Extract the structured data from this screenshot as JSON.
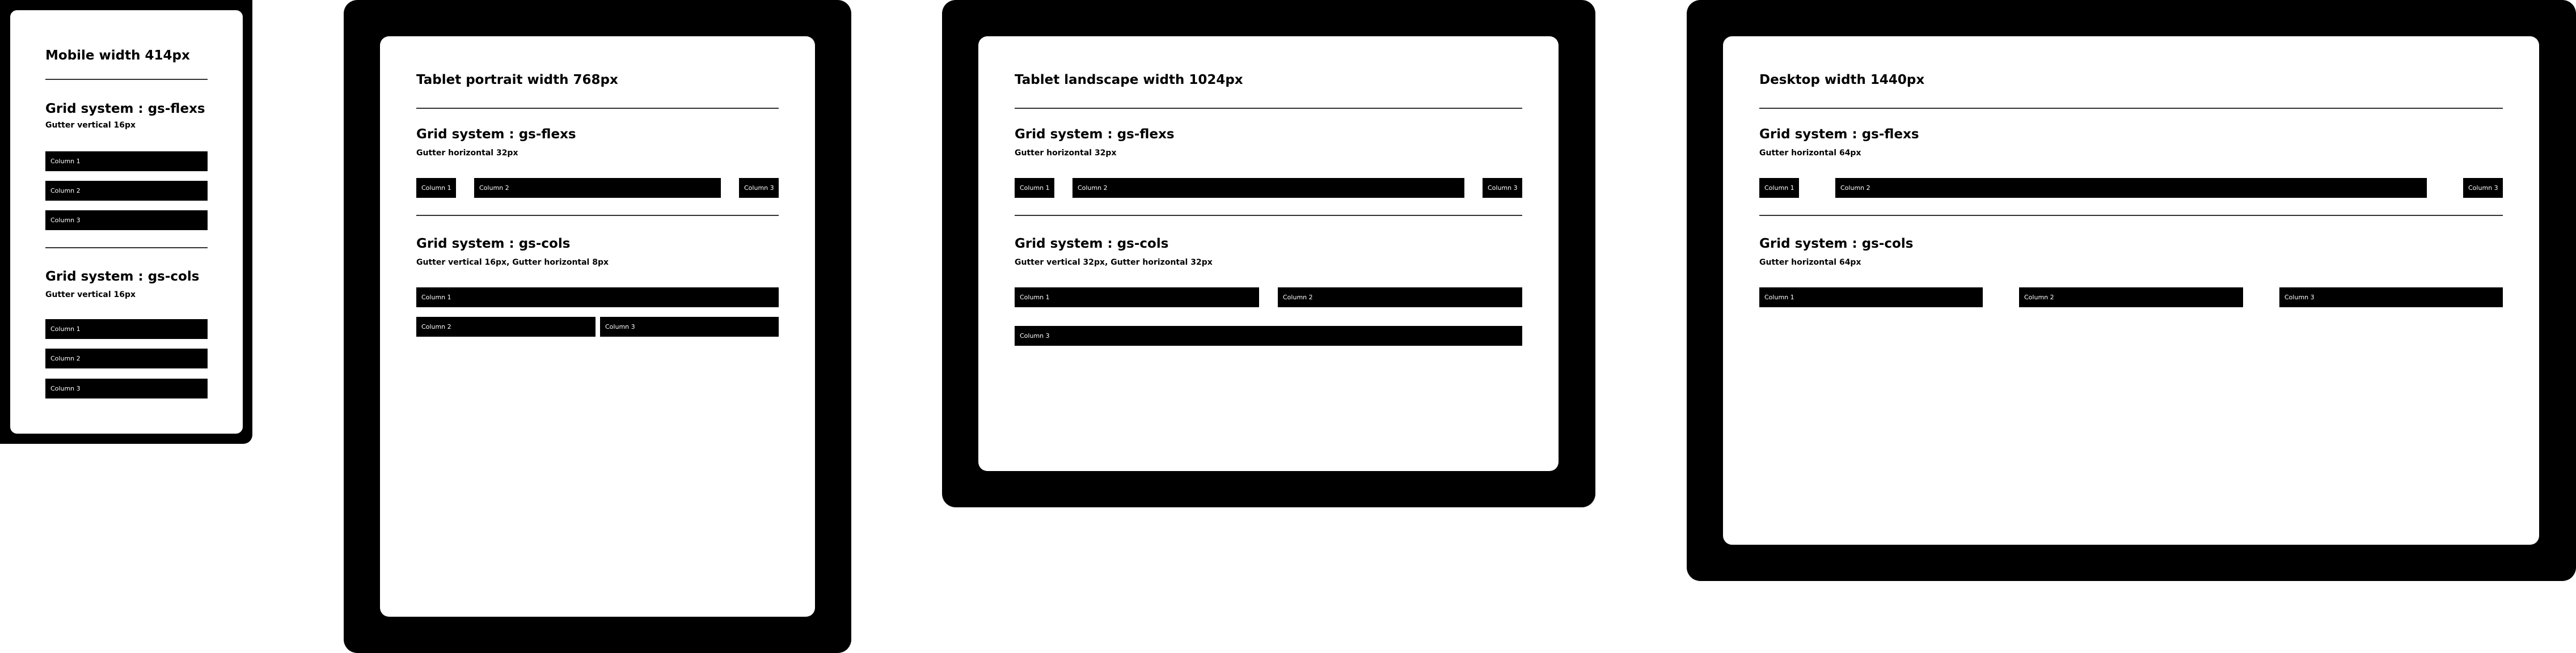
{
  "mobile": {
    "title": "Mobile width 414px",
    "flex": {
      "heading": "Grid system : gs-flexs",
      "gutter": "Gutter vertical 16px",
      "columns": [
        "Column 1",
        "Column 2",
        "Column 3"
      ]
    },
    "cols": {
      "heading": "Grid system : gs-cols",
      "gutter": "Gutter vertical 16px",
      "columns": [
        "Column 1",
        "Column 2",
        "Column 3"
      ]
    }
  },
  "tablet_portrait": {
    "title": "Tablet portrait width 768px",
    "flex": {
      "heading": "Grid system : gs-flexs",
      "gutter": "Gutter horizontal 32px",
      "columns": [
        "Column 1",
        "Column 2",
        "Column 3"
      ]
    },
    "cols": {
      "heading": "Grid system : gs-cols",
      "gutter": "Gutter vertical 16px, Gutter horizontal 8px",
      "columns": [
        "Column 1",
        "Column 2",
        "Column 3"
      ]
    }
  },
  "tablet_landscape": {
    "title": "Tablet landscape width 1024px",
    "flex": {
      "heading": "Grid system : gs-flexs",
      "gutter": "Gutter horizontal 32px",
      "columns": [
        "Column 1",
        "Column 2",
        "Column 3"
      ]
    },
    "cols": {
      "heading": "Grid system : gs-cols",
      "gutter": "Gutter vertical 32px, Gutter horizontal 32px",
      "columns": [
        "Column 1",
        "Column 2",
        "Column 3"
      ]
    }
  },
  "desktop": {
    "title": "Desktop width 1440px",
    "flex": {
      "heading": "Grid system : gs-flexs",
      "gutter": "Gutter horizontal 64px",
      "columns": [
        "Column 1",
        "Column 2",
        "Column 3"
      ]
    },
    "cols": {
      "heading": "Grid system : gs-cols",
      "gutter": "Gutter horizontal 64px",
      "columns": [
        "Column 1",
        "Column 2",
        "Column 3"
      ]
    }
  }
}
